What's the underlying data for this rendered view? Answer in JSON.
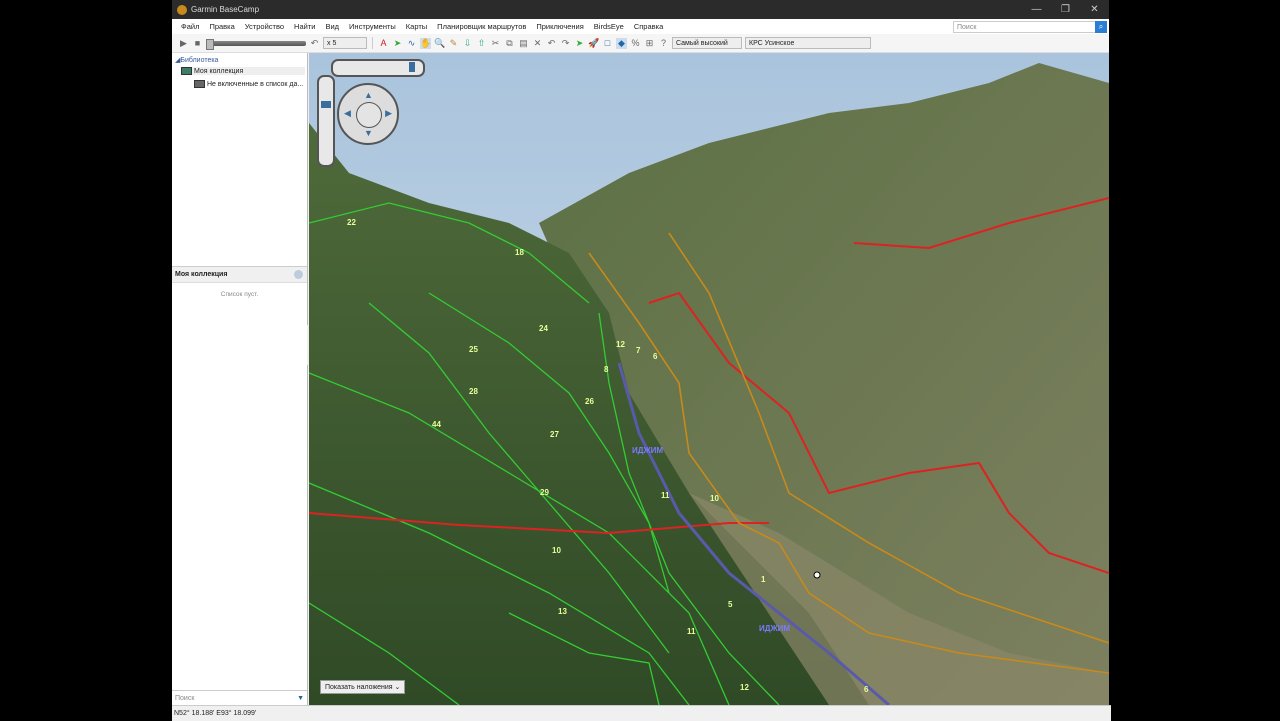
{
  "app": {
    "title": "Garmin BaseCamp"
  },
  "window_controls": {
    "minimize": "—",
    "maximize": "❐",
    "close": "✕"
  },
  "menu": [
    "Файл",
    "Правка",
    "Устройство",
    "Найти",
    "Вид",
    "Инструменты",
    "Карты",
    "Планировщик маршрутов",
    "Приключения",
    "BirdsEye",
    "Справка"
  ],
  "search": {
    "placeholder": "Поиск"
  },
  "toolbar": {
    "speed": "x 5",
    "detail": "Самый высокий",
    "map": "КРС Усинское"
  },
  "library": {
    "root": "Библиотека",
    "collection": "Моя коллекция",
    "unlisted": "Не включенные в список да..."
  },
  "collection_panel": {
    "title": "Моя коллекция",
    "empty": "Список пуст."
  },
  "left_search": {
    "placeholder": "Поиск"
  },
  "map": {
    "overlay_button": "Показать наложения",
    "labels": [
      "22",
      "18",
      "24",
      "25",
      "28",
      "44",
      "27",
      "26",
      "29",
      "10",
      "13",
      "11",
      "10",
      "11",
      "5",
      "1",
      "12",
      "7",
      "6",
      "8",
      "12",
      "6"
    ],
    "rivers": [
      "ИДЖИМ",
      "ИДЖИМ"
    ]
  },
  "status": {
    "coordinates": "N52° 18.188' E93° 18.099'"
  }
}
